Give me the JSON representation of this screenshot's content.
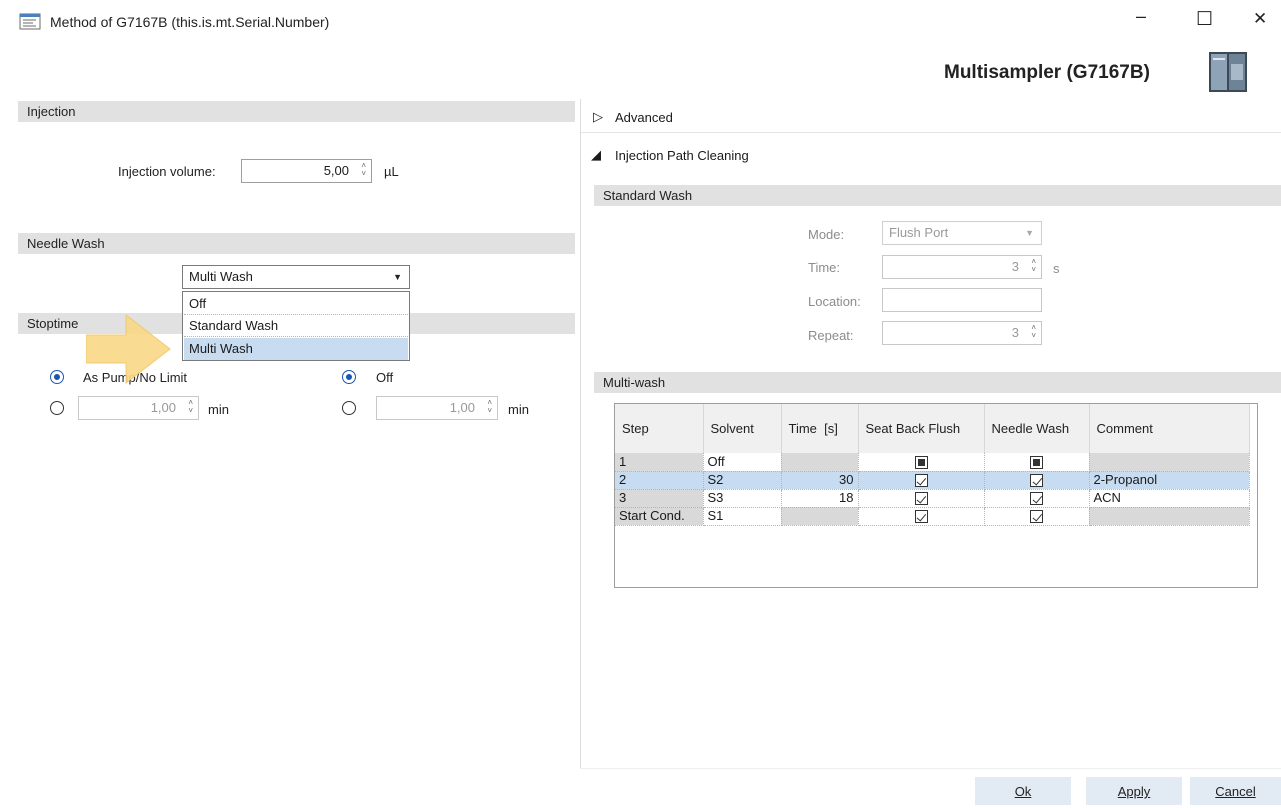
{
  "window": {
    "title": "Method of G7167B (this.is.mt.Serial.Number)",
    "device_title": "Multisampler (G7167B)",
    "minimize_glyph": "–",
    "maximize_glyph": "☐",
    "close_glyph": "✕"
  },
  "injection": {
    "section": "Injection",
    "volume_label": "Injection volume:",
    "volume_value": "5,00",
    "volume_unit": "µL"
  },
  "needle_wash": {
    "section": "Needle Wash",
    "selected": "Multi Wash",
    "options": [
      "Off",
      "Standard Wash",
      "Multi Wash"
    ]
  },
  "stoptime": {
    "section": "Stoptime",
    "left_option_label": "As Pump/No Limit",
    "left_value": "1,00",
    "left_unit": "min",
    "right_option_label": "Off",
    "right_value": "1,00",
    "right_unit": "min"
  },
  "advanced": {
    "label": "Advanced",
    "expanded": false
  },
  "injection_path_cleaning": {
    "label": "Injection Path Cleaning",
    "expanded": true
  },
  "standard_wash": {
    "section": "Standard Wash",
    "mode_label": "Mode:",
    "mode_value": "Flush Port",
    "time_label": "Time:",
    "time_value": "3",
    "time_unit": "s",
    "location_label": "Location:",
    "location_value": "",
    "repeat_label": "Repeat:",
    "repeat_value": "3"
  },
  "multi_wash": {
    "section": "Multi-wash",
    "columns": [
      "Step",
      "Solvent",
      "Time  [s]",
      "Seat Back Flush",
      "Needle Wash",
      "Comment"
    ],
    "rows": [
      {
        "step": "1",
        "solvent": "Off",
        "time": "",
        "seat_back_flush": "indeterminate",
        "needle_wash": "indeterminate",
        "comment": ""
      },
      {
        "step": "2",
        "solvent": "S2",
        "time": "30",
        "seat_back_flush": "checked",
        "needle_wash": "checked",
        "comment": "2-Propanol"
      },
      {
        "step": "3",
        "solvent": "S3",
        "time": "18",
        "seat_back_flush": "checked",
        "needle_wash": "checked",
        "comment": "ACN"
      },
      {
        "step": "Start Cond.",
        "solvent": "S1",
        "time": "",
        "seat_back_flush": "checked",
        "needle_wash": "checked",
        "comment": ""
      }
    ]
  },
  "buttons": {
    "ok": "Ok",
    "apply": "Apply",
    "cancel": "Cancel"
  },
  "colors": {
    "section_header": "#e1e1e1",
    "selection": "#c7dcf1",
    "arrow_fill": "#f9d889",
    "button_bg": "#e2eaf4"
  }
}
